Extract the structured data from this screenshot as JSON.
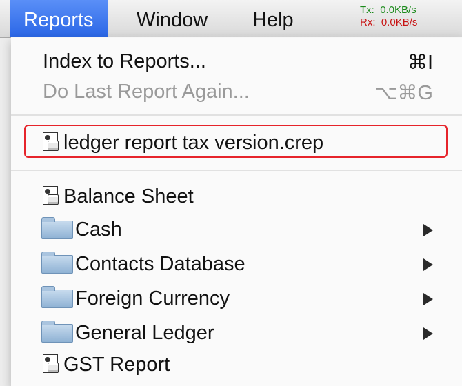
{
  "menubar": {
    "items": [
      {
        "label": "Reports"
      },
      {
        "label": "Window"
      },
      {
        "label": "Help"
      }
    ],
    "network": {
      "tx_label": "Tx:",
      "tx_value": "0.0KB/s",
      "rx_label": "Rx:",
      "rx_value": "0.0KB/s"
    }
  },
  "menu": {
    "items": [
      {
        "label": "Index to Reports...",
        "shortcut": "⌘I",
        "enabled": true
      },
      {
        "label": "Do Last Report Again...",
        "shortcut": "⌥⌘G",
        "enabled": false
      },
      {
        "label": "ledger report tax version.crep",
        "icon": "report-doc-icon",
        "highlighted": true
      },
      {
        "label": "Balance Sheet",
        "icon": "report-doc-icon"
      },
      {
        "label": "Cash",
        "icon": "folder-icon",
        "submenu": true
      },
      {
        "label": "Contacts Database",
        "icon": "folder-icon",
        "submenu": true
      },
      {
        "label": "Foreign Currency",
        "icon": "folder-icon",
        "submenu": true
      },
      {
        "label": "General Ledger",
        "icon": "folder-icon",
        "submenu": true
      },
      {
        "label": "GST Report",
        "icon": "report-doc-icon"
      }
    ]
  },
  "colors": {
    "menubar_active": "#2a66e6",
    "highlight_box": "#e6242b",
    "disabled_text": "#9a9a9a"
  }
}
